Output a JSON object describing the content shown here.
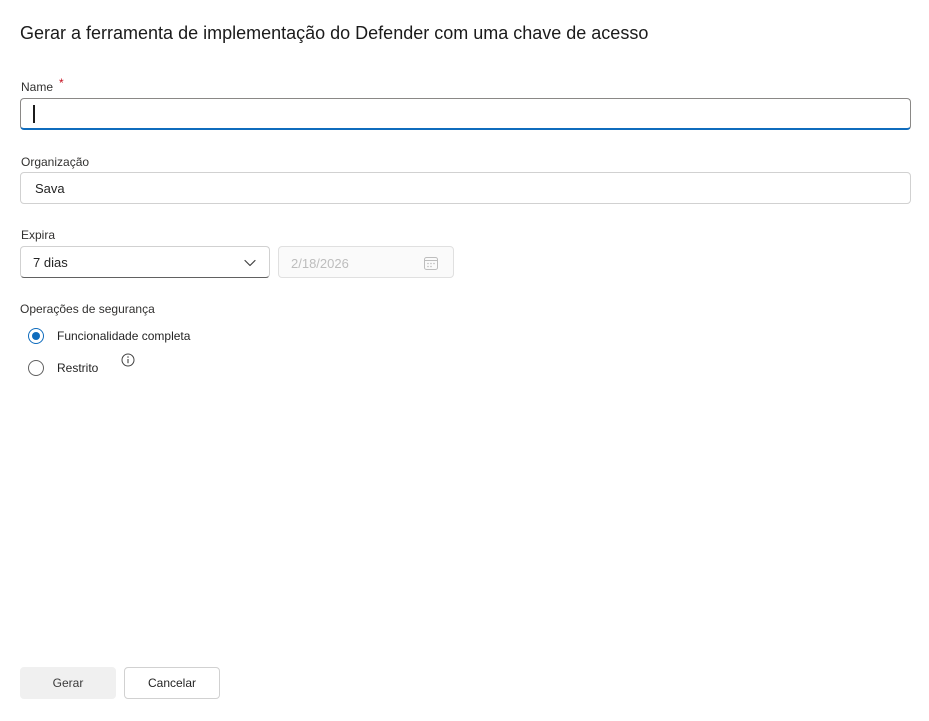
{
  "panel": {
    "title": "Gerar a ferramenta de implementação do Defender com uma chave de acesso"
  },
  "form": {
    "name": {
      "label": "Name",
      "required_marker": "*",
      "value": ""
    },
    "organization": {
      "label": "Organização",
      "value": "Sava"
    },
    "expires": {
      "label": "Expira",
      "selected": "7 dias",
      "date": "2/18/2026"
    },
    "security_operations": {
      "label": "Operações de segurança",
      "options": [
        {
          "label": "Funcionalidade completa",
          "checked": true
        },
        {
          "label": "Restrito",
          "checked": false
        }
      ]
    }
  },
  "footer": {
    "generate_label": "Gerar",
    "cancel_label": "Cancelar"
  },
  "colors": {
    "accent": "#0f6cbd",
    "required": "#c50f1f"
  },
  "icons": {
    "dropdown": "chevron-down-icon",
    "date": "calendar-icon",
    "info": "info-icon"
  }
}
